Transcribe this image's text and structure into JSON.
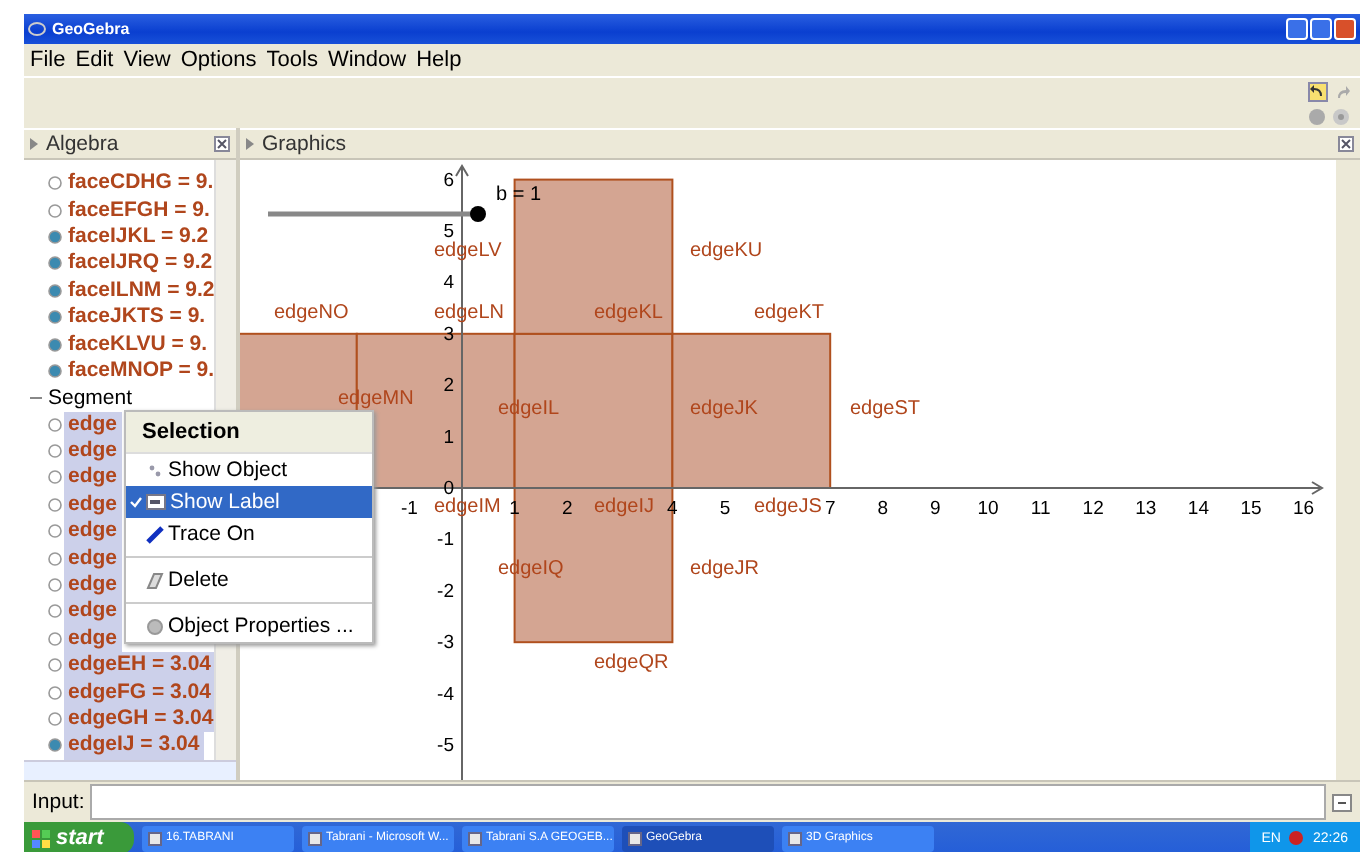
{
  "window": {
    "title": "GeoGebra"
  },
  "menu": [
    "File",
    "Edit",
    "View",
    "Options",
    "Tools",
    "Window",
    "Help"
  ],
  "algebra": {
    "title": "Algebra",
    "tree": [
      {
        "kind": "item",
        "label": "faceCDHG = 9.",
        "visible": false,
        "selected": false
      },
      {
        "kind": "item",
        "label": "faceEFGH = 9.",
        "visible": false,
        "selected": false
      },
      {
        "kind": "item",
        "label": "faceIJKL = 9.2",
        "visible": true,
        "selected": false
      },
      {
        "kind": "item",
        "label": "faceIJRQ = 9.2",
        "visible": true,
        "selected": false
      },
      {
        "kind": "item",
        "label": "faceILNM = 9.2",
        "visible": true,
        "selected": false
      },
      {
        "kind": "item",
        "label": "faceJKTS = 9.",
        "visible": true,
        "selected": false
      },
      {
        "kind": "item",
        "label": "faceKLVU = 9.",
        "visible": true,
        "selected": false
      },
      {
        "kind": "item",
        "label": "faceMNOP = 9.",
        "visible": true,
        "selected": false
      },
      {
        "kind": "group",
        "label": "Segment",
        "expanded": true,
        "children": [
          {
            "kind": "item",
            "label": "edge",
            "visible": false,
            "selected": true
          },
          {
            "kind": "item",
            "label": "edge",
            "visible": false,
            "selected": true
          },
          {
            "kind": "item",
            "label": "edge",
            "visible": false,
            "selected": true
          },
          {
            "kind": "item",
            "label": "edge",
            "visible": false,
            "selected": true
          },
          {
            "kind": "item",
            "label": "edge",
            "visible": false,
            "selected": true
          },
          {
            "kind": "item",
            "label": "edge",
            "visible": false,
            "selected": true
          },
          {
            "kind": "item",
            "label": "edge",
            "visible": false,
            "selected": true
          },
          {
            "kind": "item",
            "label": "edge",
            "visible": false,
            "selected": true
          },
          {
            "kind": "item",
            "label": "edge",
            "visible": false,
            "selected": true
          },
          {
            "kind": "item",
            "label": "edgeEH = 3.04",
            "visible": false,
            "selected": true
          },
          {
            "kind": "item",
            "label": "edgeFG = 3.04",
            "visible": false,
            "selected": true
          },
          {
            "kind": "item",
            "label": "edgeGH = 3.04",
            "visible": false,
            "selected": true
          },
          {
            "kind": "item",
            "label": "edgeIJ = 3.04",
            "visible": true,
            "selected": true
          }
        ]
      }
    ]
  },
  "graphics": {
    "title": "Graphics",
    "slider": {
      "label": "b = 1",
      "level": 1
    },
    "x_ticks": [
      "-1",
      "1",
      "2",
      "4",
      "5",
      "7",
      "8",
      "9",
      "10",
      "11",
      "12",
      "13",
      "14",
      "15",
      "16"
    ],
    "y_ticks": [
      "6",
      "5",
      "4",
      "3",
      "2",
      "1",
      "0",
      "-1",
      "-2",
      "-3",
      "-4",
      "-5"
    ],
    "labels": [
      "edgeLV",
      "edgeKU",
      "edgeNO",
      "edgeLN",
      "edgeKL",
      "edgeKT",
      "edgeMN",
      "edgeIL",
      "edgeJK",
      "edgeST",
      "edgeIM",
      "edgeIJ",
      "edgeJS",
      "edgeIQ",
      "edgeJR",
      "edgeQR"
    ]
  },
  "context_menu": {
    "title": "Selection",
    "items": [
      {
        "kind": "item",
        "label": "Show Object",
        "checked": false,
        "selected": false
      },
      {
        "kind": "item",
        "label": "Show Label",
        "checked": true,
        "selected": true
      },
      {
        "kind": "item",
        "label": "Trace On",
        "checked": false,
        "selected": false
      },
      {
        "kind": "separator"
      },
      {
        "kind": "item",
        "label": "Delete",
        "checked": false,
        "selected": false
      },
      {
        "kind": "separator"
      },
      {
        "kind": "item",
        "label": "Object Properties ...",
        "checked": false,
        "selected": false
      }
    ]
  },
  "input": {
    "label": "Input:"
  },
  "taskbar": {
    "start": "start",
    "tasks": [
      {
        "label": "16.TABRANI",
        "selected": false
      },
      {
        "label": "Tabrani - Microsoft W...",
        "selected": false
      },
      {
        "label": "Tabrani S.A GEOGEB...",
        "selected": false
      },
      {
        "label": "GeoGebra",
        "selected": true
      },
      {
        "label": "3D Graphics",
        "selected": false
      }
    ],
    "language": "EN",
    "time": "22:26"
  }
}
